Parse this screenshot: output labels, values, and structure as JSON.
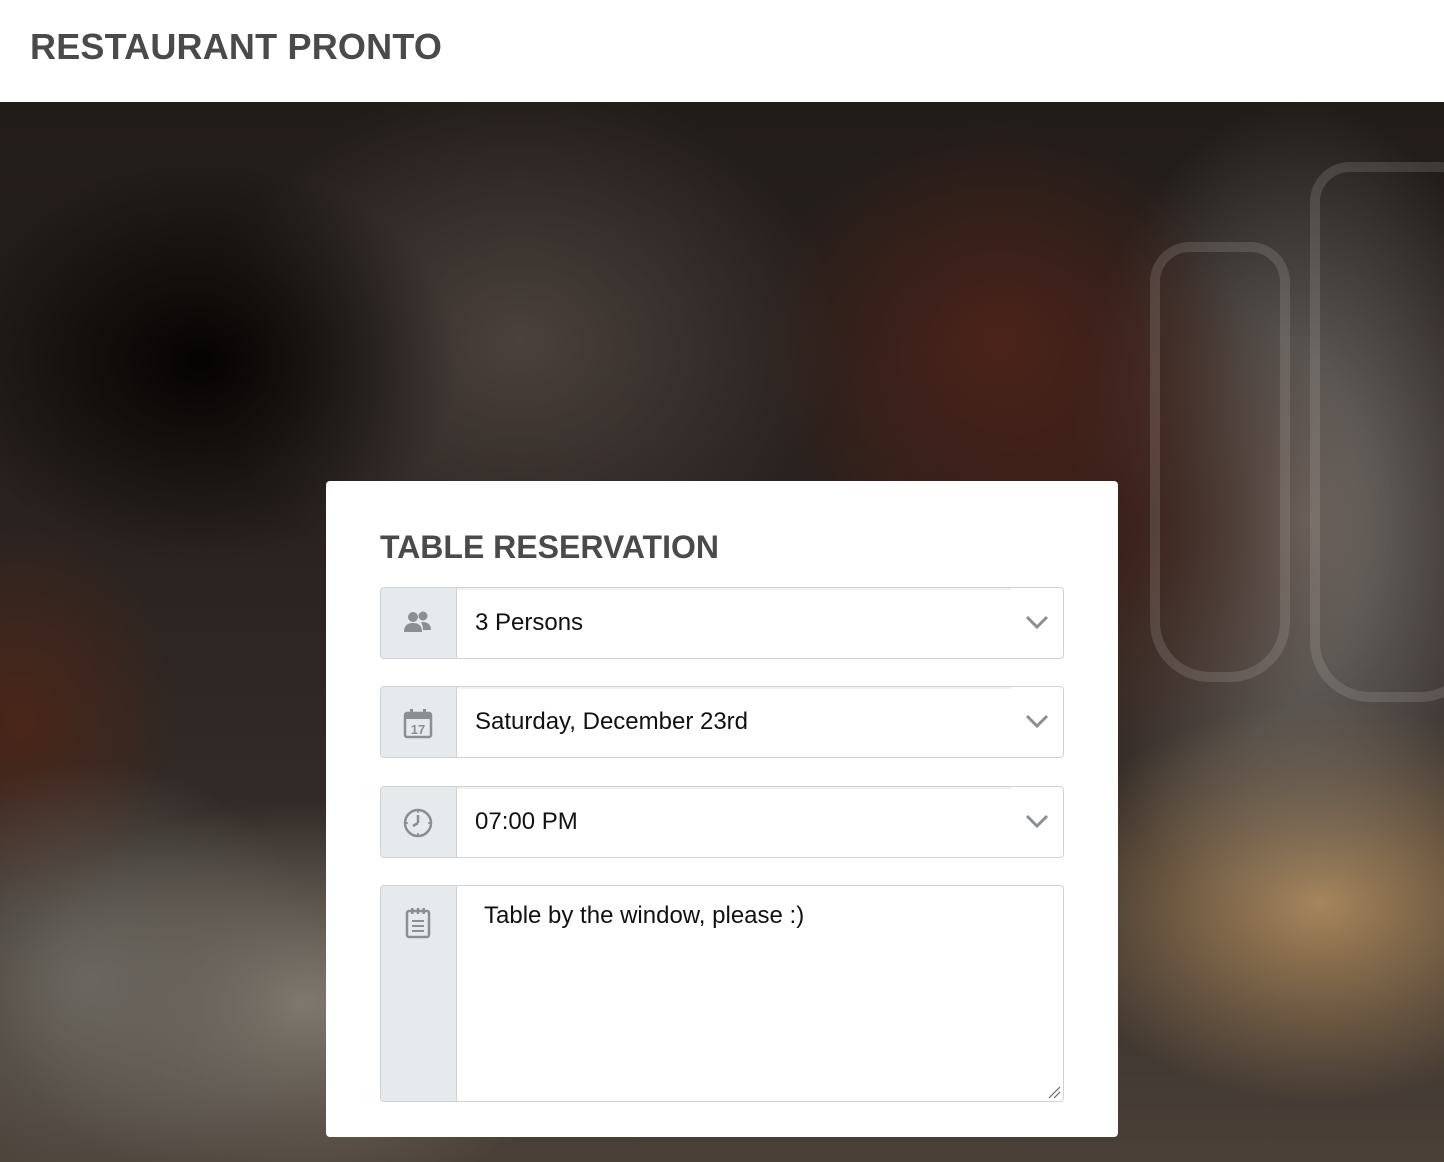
{
  "header": {
    "brand": "RESTAURANT PRONTO"
  },
  "form": {
    "title": "TABLE RESERVATION",
    "guests": {
      "icon": "users-icon",
      "value": "3 Persons"
    },
    "date": {
      "icon": "calendar-icon",
      "icon_text": "17",
      "value": "Saturday, December 23rd"
    },
    "time": {
      "icon": "clock-icon",
      "value": "07:00 PM"
    },
    "note": {
      "icon": "notepad-icon",
      "value": "Table by the window, please :)"
    }
  },
  "colors": {
    "heading": "#4a4a4a",
    "addon_bg": "#e7eaed",
    "border": "#cfd3d7",
    "icon": "#8a8f94"
  }
}
